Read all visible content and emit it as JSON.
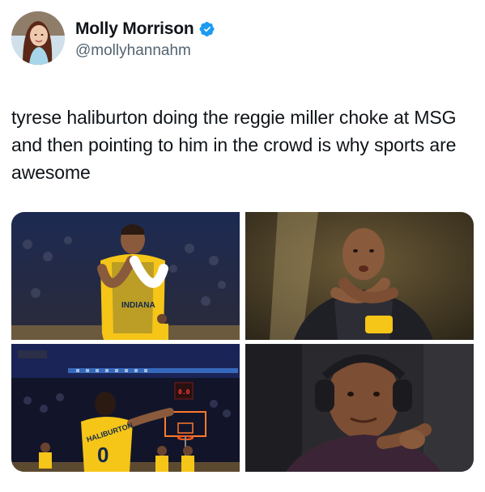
{
  "author": {
    "display_name": "Molly Morrison",
    "handle": "@mollyhannahm",
    "verified": true,
    "avatar_icon": "profile-photo"
  },
  "tweet": {
    "text": "tyrese haliburton doing the reggie miller choke at MSG and then pointing to him in the crowd is why sports are awesome"
  },
  "media": {
    "jersey_text_1": "HALIBURTON",
    "jersey_number_1": "0",
    "shot_clock": "0.0",
    "items": [
      {
        "icon": "photo-haliburton-choke"
      },
      {
        "icon": "photo-miller-choke"
      },
      {
        "icon": "photo-haliburton-shot"
      },
      {
        "icon": "photo-miller-pointing"
      }
    ]
  },
  "colors": {
    "verified_blue": "#1d9bf0",
    "text": "#0f1419",
    "secondary_text": "#536471",
    "pacers_gold": "#f5c518",
    "pacers_navy": "#13294b"
  }
}
